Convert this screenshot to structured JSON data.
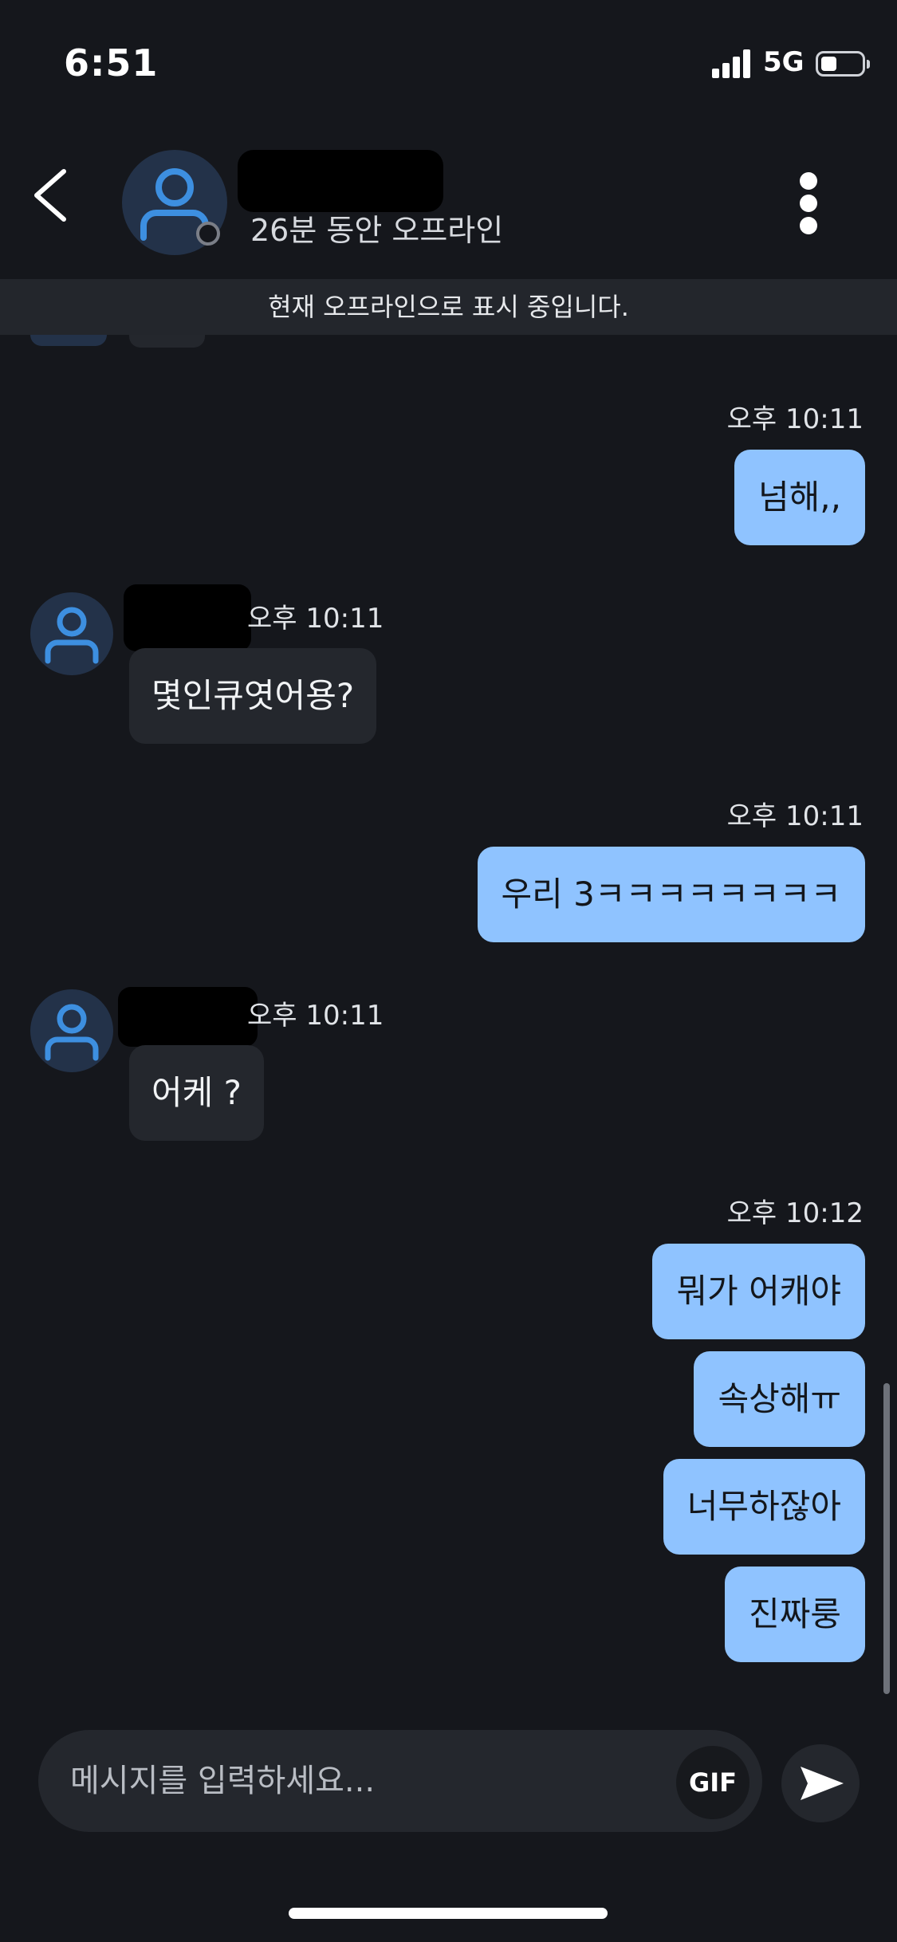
{
  "status_bar": {
    "time": "6:51",
    "network": "5G",
    "battery_level": 0.4
  },
  "header": {
    "status_text": "26분 동안 오프라인"
  },
  "banner": {
    "text": "현재 오프라인으로 표시 중입니다."
  },
  "messages": [
    {
      "side": "out",
      "time": "오후 10:11",
      "text": "넘해,,"
    },
    {
      "side": "in",
      "time": "오후 10:11",
      "text": "몇인큐엿어용?"
    },
    {
      "side": "out",
      "time": "오후 10:11",
      "text": "우리 3ㅋㅋㅋㅋㅋㅋㅋㅋ"
    },
    {
      "side": "in",
      "time": "오후 10:11",
      "text": "어케 ?"
    },
    {
      "side": "out",
      "time": "오후 10:12",
      "text": "뭐가 어캐야"
    },
    {
      "side": "out",
      "time": "",
      "text": "속상해ㅠ"
    },
    {
      "side": "out",
      "time": "",
      "text": "너무하잖아"
    },
    {
      "side": "out",
      "time": "",
      "text": "진짜룽"
    }
  ],
  "composer": {
    "placeholder": "메시지를 입력하세요...",
    "gif_label": "GIF"
  },
  "icons": {
    "back": "chevron-left-icon",
    "menu": "kebab-menu-icon",
    "avatar": "user-icon",
    "send": "send-icon"
  },
  "colors": {
    "outgoing_bubble": "#8fc3ff",
    "incoming_bubble": "#24272d",
    "background": "#15171c",
    "avatar_accent": "#3d8fe0"
  }
}
